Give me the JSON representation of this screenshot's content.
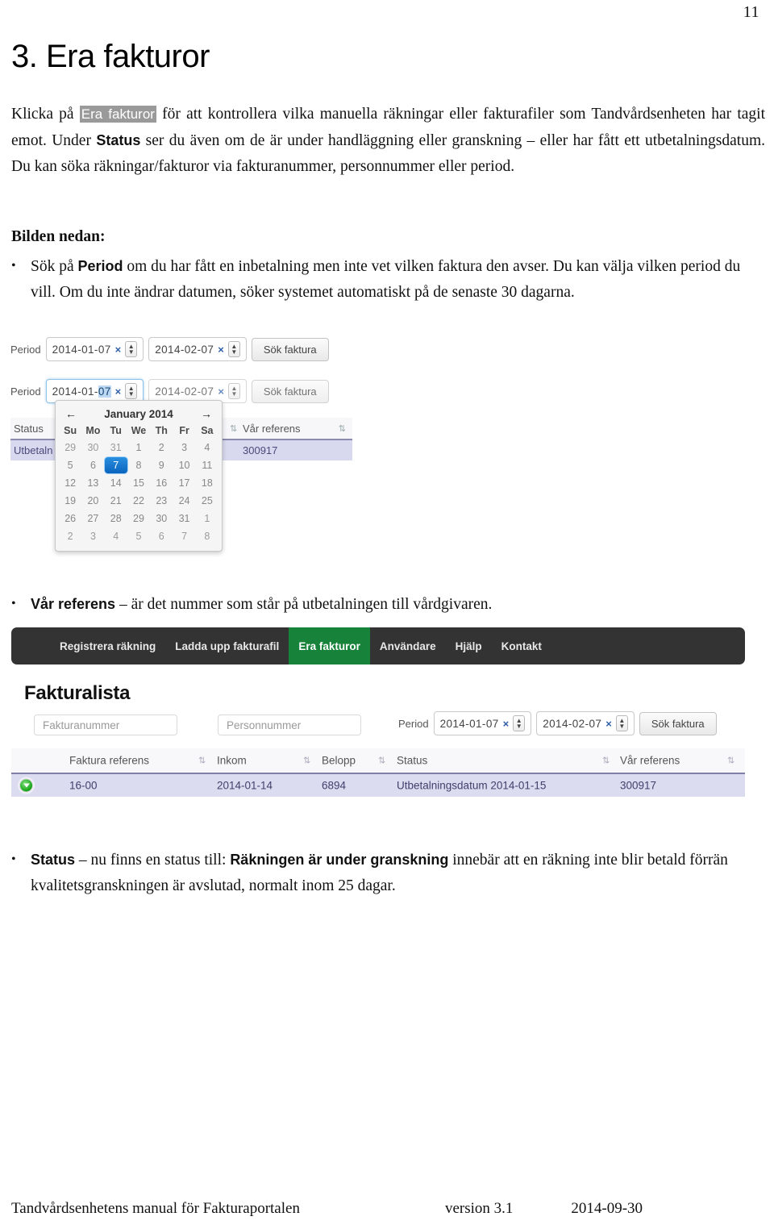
{
  "page": {
    "number": "11",
    "heading": "3. Era fakturor"
  },
  "intro": {
    "p1_before": "Klicka på ",
    "p1_highlight": "Era fakturor",
    "p1_after": " för att kontrollera vilka manuella räkningar eller fakturafiler som Tandvårdsenheten har tagit emot. Under ",
    "p1_bold": "Status",
    "p1_rest": " ser du även om de är under handläggning eller granskning – eller har fått ett utbetalningsdatum. Du kan söka räkningar/fakturor via fakturanummer, personnummer eller period."
  },
  "bilden_label": "Bilden nedan:",
  "bullets": {
    "b1_before": "Sök på ",
    "b1_bold": "Period",
    "b1_after": " om du har fått en inbetalning men inte vet vilken faktura den avser. Du kan välja vilken period du vill. Om du inte ändrar datumen, söker systemet automatiskt på de senaste 30 dagarna.",
    "b2_bold": "Vår referens",
    "b2_after": " – är det nummer som står på utbetalningen till vårdgivaren.",
    "b3_bold": "Status",
    "b3_mid": " – nu finns en status till: ",
    "b3_bold2": "Räkningen är under granskning",
    "b3_after": " innebär att en räkning inte blir betald förrän kvalitetsgranskningen är avslutad, normalt inom 25 dagar."
  },
  "period_widget": {
    "label": "Period",
    "from_value": "2014-01-07",
    "from_value_prefix": "2014-01-",
    "from_value_selected": "07",
    "to_value": "2014-02-07",
    "clear_icon": "×",
    "spinner_up_icon": "▲",
    "spinner_down_icon": "▼",
    "search_button": "Sök faktura"
  },
  "calendar": {
    "prev_icon": "←",
    "next_icon": "→",
    "title": "January 2014",
    "weekdays": [
      "Su",
      "Mo",
      "Tu",
      "We",
      "Th",
      "Fr",
      "Sa"
    ],
    "weeks": [
      [
        {
          "d": "29",
          "other": true
        },
        {
          "d": "30",
          "other": true
        },
        {
          "d": "31",
          "other": true
        },
        {
          "d": "1",
          "other": false
        },
        {
          "d": "2",
          "other": false
        },
        {
          "d": "3",
          "other": false
        },
        {
          "d": "4",
          "other": false
        }
      ],
      [
        {
          "d": "5",
          "other": false
        },
        {
          "d": "6",
          "other": false
        },
        {
          "d": "7",
          "other": false,
          "selected": true
        },
        {
          "d": "8",
          "other": false
        },
        {
          "d": "9",
          "other": false
        },
        {
          "d": "10",
          "other": false
        },
        {
          "d": "11",
          "other": false
        }
      ],
      [
        {
          "d": "12",
          "other": false
        },
        {
          "d": "13",
          "other": false
        },
        {
          "d": "14",
          "other": false
        },
        {
          "d": "15",
          "other": false
        },
        {
          "d": "16",
          "other": false
        },
        {
          "d": "17",
          "other": false
        },
        {
          "d": "18",
          "other": false
        }
      ],
      [
        {
          "d": "19",
          "other": false
        },
        {
          "d": "20",
          "other": false
        },
        {
          "d": "21",
          "other": false
        },
        {
          "d": "22",
          "other": false
        },
        {
          "d": "23",
          "other": false
        },
        {
          "d": "24",
          "other": false
        },
        {
          "d": "25",
          "other": false
        }
      ],
      [
        {
          "d": "26",
          "other": false
        },
        {
          "d": "27",
          "other": false
        },
        {
          "d": "28",
          "other": false
        },
        {
          "d": "29",
          "other": false
        },
        {
          "d": "30",
          "other": false
        },
        {
          "d": "31",
          "other": false
        },
        {
          "d": "1",
          "other": true
        }
      ],
      [
        {
          "d": "2",
          "other": true
        },
        {
          "d": "3",
          "other": true
        },
        {
          "d": "4",
          "other": true
        },
        {
          "d": "5",
          "other": true
        },
        {
          "d": "6",
          "other": true
        },
        {
          "d": "7",
          "other": true
        },
        {
          "d": "8",
          "other": true
        }
      ]
    ]
  },
  "ghost_table": {
    "status_header": "Status",
    "var_referens_header": "Vår referens",
    "status_cell": "Utbetaln",
    "var_referens_cell": "300917",
    "sort_icon": "⇅"
  },
  "app": {
    "nav": {
      "items": [
        {
          "label": "Registrera räkning",
          "active": false
        },
        {
          "label": "Ladda upp fakturafil",
          "active": false
        },
        {
          "label": "Era fakturor",
          "active": true
        },
        {
          "label": "Användare",
          "active": false
        },
        {
          "label": "Hjälp",
          "active": false
        },
        {
          "label": "Kontakt",
          "active": false
        }
      ],
      "active_color": "#17833a",
      "bar_color": "#333333"
    },
    "list_title": "Fakturalista",
    "inputs": {
      "fakturanummer_placeholder": "Fakturanummer",
      "personnummer_placeholder": "Personnummer"
    },
    "table": {
      "headers": [
        "Faktura referens",
        "Inkom",
        "Belopp",
        "Status",
        "Vår referens"
      ],
      "sort_icon": "⇅",
      "rows": [
        {
          "expand_icon": "expand-green-icon",
          "faktura_referens": "16-00",
          "inkom": "2014-01-14",
          "belopp": "6894",
          "status": "Utbetalningsdatum 2014-01-15",
          "var_referens": "300917"
        }
      ]
    }
  },
  "footer": {
    "left": "Tandvårdsenhetens manual för Fakturaportalen",
    "version": "version 3.1",
    "date": "2014-09-30"
  }
}
